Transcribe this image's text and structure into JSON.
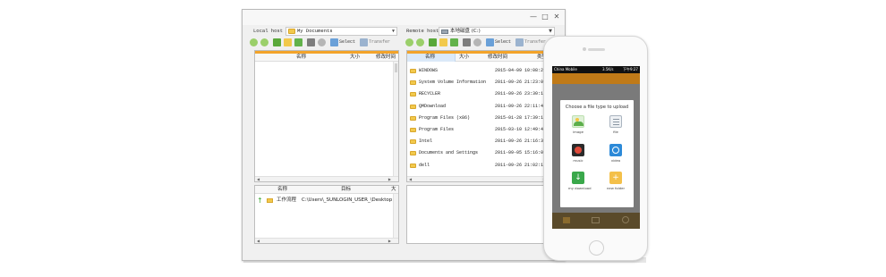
{
  "window": {
    "local": {
      "header": "Local host",
      "path": "My Documents",
      "toolbar": {
        "select_label": "Select",
        "transfer_label": "Transfer"
      },
      "file_columns": [
        "名称",
        "大小",
        "修改时间"
      ]
    },
    "remote": {
      "header": "Remote host",
      "path": "本地磁盘 (C:)",
      "toolbar": {
        "select_label": "Select",
        "transfer_label": "Transfer"
      },
      "columns": [
        "名称",
        "大小",
        "修改时间",
        "类型"
      ],
      "files": [
        {
          "name": "WINDOWS",
          "date": "2015-04-09 10:08:21"
        },
        {
          "name": "System Volume Information",
          "date": "2011-09-26 21:23:04"
        },
        {
          "name": "RECYCLER",
          "date": "2011-09-26 23:30:11"
        },
        {
          "name": "QMDownload",
          "date": "2011-09-26 22:11:44"
        },
        {
          "name": "Program Files (x86)",
          "date": "2015-01-28 17:39:10"
        },
        {
          "name": "Program Files",
          "date": "2015-03-10 12:49:43"
        },
        {
          "name": "Intel",
          "date": "2011-09-26 21:16:30"
        },
        {
          "name": "Documents and Settings",
          "date": "2011-09-05 15:16:02"
        },
        {
          "name": "dell",
          "date": "2011-09-26 21:02:13"
        }
      ]
    },
    "transfers": {
      "columns": [
        "名称",
        "目标",
        "大"
      ],
      "rows": [
        {
          "name": "工作流程",
          "target": "C:\\Users\\_SUNLOGIN_USER_\\Desktop"
        }
      ]
    }
  },
  "phone": {
    "status": {
      "carrier": "China Mobile",
      "speed": "3.5K/s",
      "time": "下午9:27"
    },
    "dialog": {
      "title": "Choose a file type to upload",
      "options": [
        {
          "label": "image",
          "icon": "image-icon"
        },
        {
          "label": "file",
          "icon": "file-icon"
        },
        {
          "label": "music",
          "icon": "music-icon"
        },
        {
          "label": "video",
          "icon": "video-icon"
        },
        {
          "label": "my download",
          "icon": "download-icon"
        },
        {
          "label": "new folder",
          "icon": "new-folder-icon"
        }
      ]
    }
  },
  "colors": {
    "accent": "#f3a32a",
    "selected_header": "#dbe9f8",
    "folder": "#f2c94c"
  }
}
